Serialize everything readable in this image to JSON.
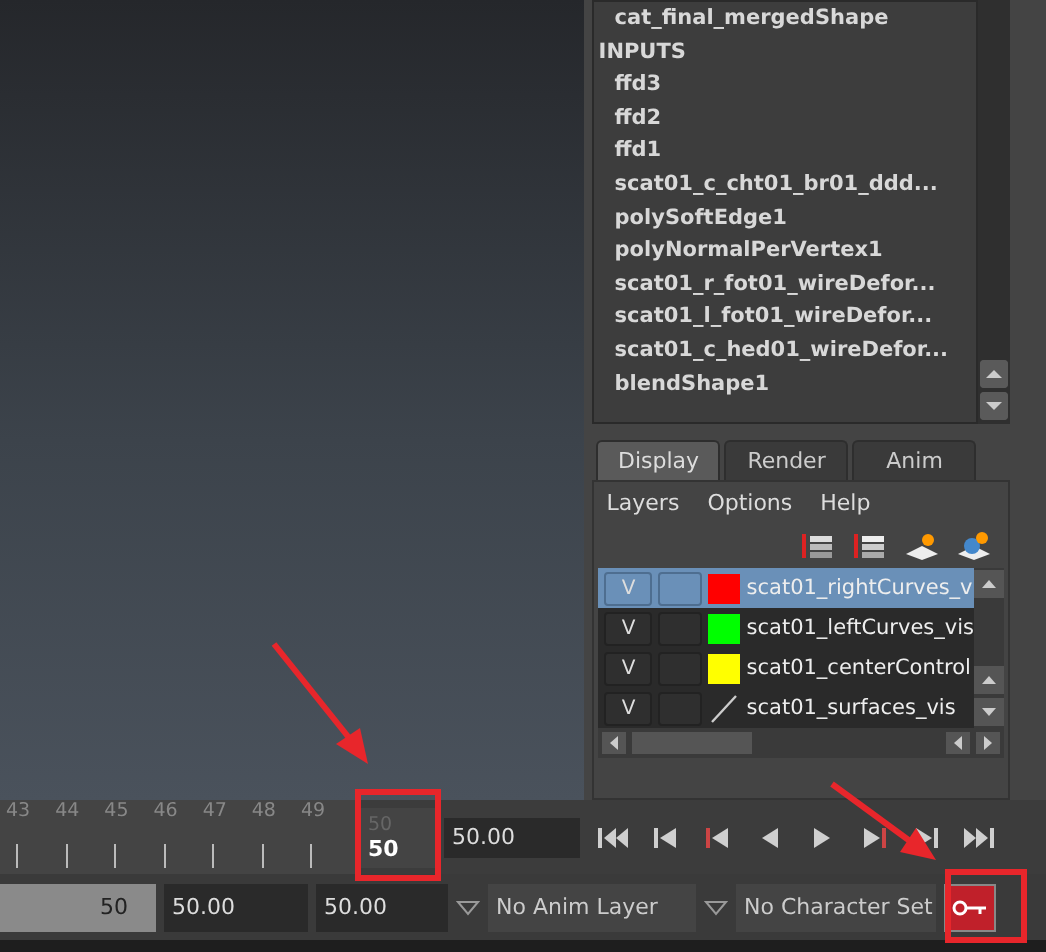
{
  "outliner": {
    "items": [
      {
        "kind": "item",
        "label": "cat_final_mergedShape"
      },
      {
        "kind": "header",
        "label": "INPUTS"
      },
      {
        "kind": "item",
        "label": "ffd3"
      },
      {
        "kind": "item",
        "label": "ffd2"
      },
      {
        "kind": "item",
        "label": "ffd1"
      },
      {
        "kind": "item",
        "label": "scat01_c_cht01_br01_ddd..."
      },
      {
        "kind": "item",
        "label": "polySoftEdge1"
      },
      {
        "kind": "item",
        "label": "polyNormalPerVertex1"
      },
      {
        "kind": "item",
        "label": "scat01_r_fot01_wireDefor..."
      },
      {
        "kind": "item",
        "label": "scat01_l_fot01_wireDefor..."
      },
      {
        "kind": "item",
        "label": "scat01_c_hed01_wireDefor..."
      },
      {
        "kind": "item",
        "label": "blendShape1"
      }
    ]
  },
  "layer_editor": {
    "tabs": [
      {
        "label": "Display",
        "selected": true
      },
      {
        "label": "Render",
        "selected": false
      },
      {
        "label": "Anim",
        "selected": false
      }
    ],
    "menu": [
      "Layers",
      "Options",
      "Help"
    ],
    "layers": [
      {
        "visibility": "V",
        "name": "scat01_rightCurves_v",
        "selected": true,
        "kind": "swatch",
        "color": "#ff0000"
      },
      {
        "visibility": "V",
        "name": "scat01_leftCurves_vis",
        "selected": false,
        "kind": "swatch",
        "color": "#00ff00"
      },
      {
        "visibility": "V",
        "name": "scat01_centerControl",
        "selected": false,
        "kind": "swatch",
        "color": "#ffff00"
      },
      {
        "visibility": "V",
        "name": "scat01_surfaces_vis",
        "selected": false,
        "kind": "line"
      }
    ]
  },
  "timeline": {
    "ticks": [
      "43",
      "44",
      "45",
      "46",
      "47",
      "48",
      "49"
    ],
    "end_tick": "50",
    "current_frame": "50",
    "current_time": "50.00"
  },
  "range_bar": {
    "slider_value": "50",
    "level": 1,
    "start_field": "50.00",
    "end_field": "50.00",
    "anim_layer": "No Anim Layer",
    "character_set": "No Character Set"
  }
}
